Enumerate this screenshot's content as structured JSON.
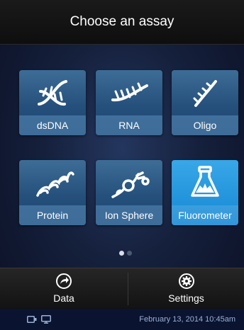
{
  "header": {
    "title": "Choose an assay"
  },
  "assays": [
    {
      "label": "dsDNA",
      "icon": "dsdna-icon",
      "selected": false
    },
    {
      "label": "RNA",
      "icon": "rna-icon",
      "selected": false
    },
    {
      "label": "Oligo",
      "icon": "oligo-icon",
      "selected": false
    },
    {
      "label": "Protein",
      "icon": "protein-icon",
      "selected": false
    },
    {
      "label": "Ion Sphere",
      "icon": "ion-sphere-icon",
      "selected": false
    },
    {
      "label": "Fluorometer",
      "icon": "fluorometer-icon",
      "selected": true
    }
  ],
  "pager": {
    "pages": 2,
    "current": 1
  },
  "footer": {
    "data_label": "Data",
    "settings_label": "Settings"
  },
  "status": {
    "datetime": "February 13, 2014 10:45am"
  },
  "colors": {
    "accent": "#1b94dd",
    "tile": "#2b5a85",
    "background": "#15203c"
  }
}
